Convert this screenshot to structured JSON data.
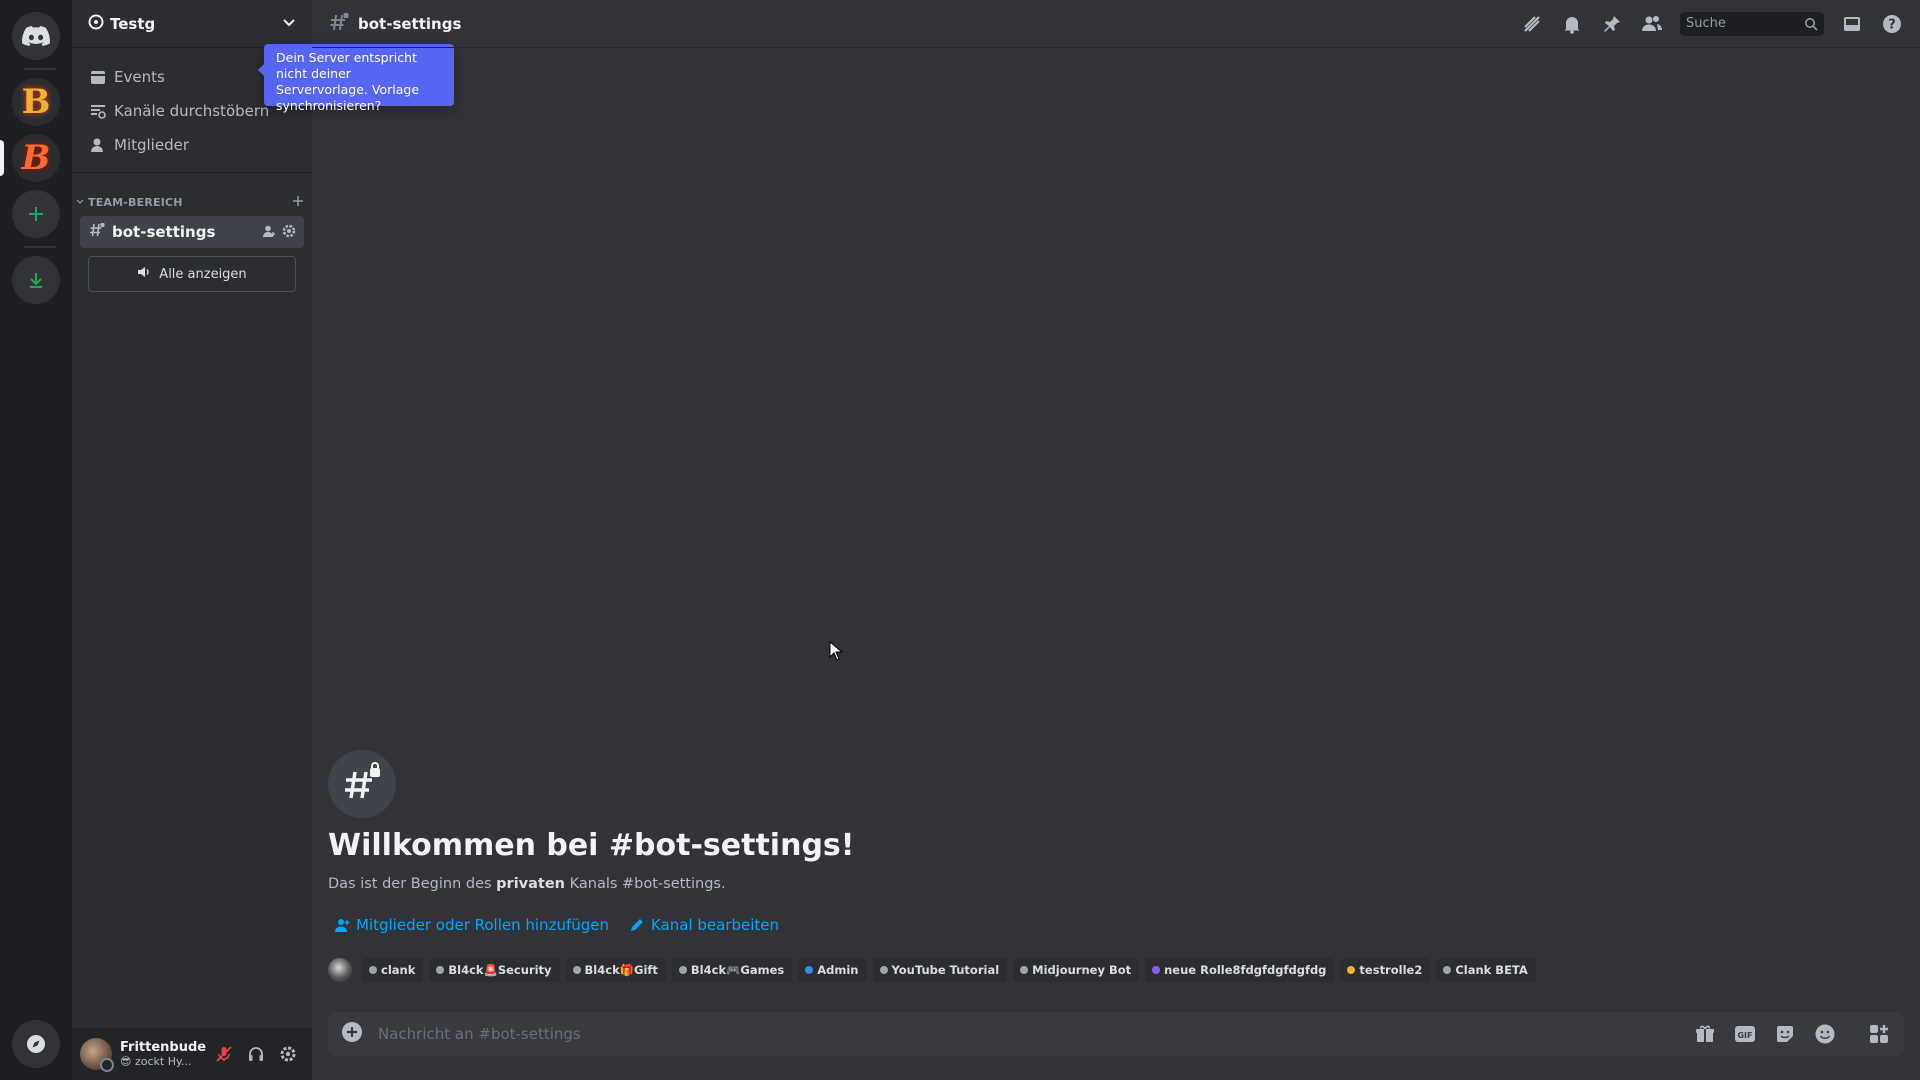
{
  "server": {
    "name": "Testg"
  },
  "tooltip": {
    "text": "Dein Server entspricht nicht deiner Servervorlage. Vorlage synchronisieren?"
  },
  "nav": [
    {
      "label": "Events",
      "icon": "calendar-icon"
    },
    {
      "label": "Kanäle durchstöbern",
      "icon": "browse-channels-icon"
    },
    {
      "label": "Mitglieder",
      "icon": "members-icon"
    }
  ],
  "category": {
    "label": "TEAM-BEREICH"
  },
  "channel": {
    "name": "bot-settings"
  },
  "show_all": {
    "label": "Alle anzeigen"
  },
  "user": {
    "name": "Frittenbude",
    "status": "😎 zockt Hy..."
  },
  "topbar": {
    "title": "bot-settings",
    "search_placeholder": "Suche"
  },
  "welcome": {
    "title": "Willkommen bei #bot-settings!",
    "sub_prefix": "Das ist der Beginn des ",
    "sub_bold": "privaten",
    "sub_suffix": " Kanals #bot-settings."
  },
  "actions": {
    "add_members": "Mitglieder oder Rollen hinzufügen",
    "edit_channel": "Kanal bearbeiten"
  },
  "roles": [
    {
      "name": "clank",
      "color": "#a0a4ab"
    },
    {
      "name": "Bl4ck🚨Security",
      "color": "#a0a4ab"
    },
    {
      "name": "Bl4ck🎁Gift",
      "color": "#a0a4ab"
    },
    {
      "name": "Bl4ck🎮Games",
      "color": "#a0a4ab"
    },
    {
      "name": "Admin",
      "color": "#3b88f5"
    },
    {
      "name": "YouTube Tutorial",
      "color": "#a0a4ab"
    },
    {
      "name": "Midjourney Bot",
      "color": "#a0a4ab"
    },
    {
      "name": "neue Rolle8fdgfdgfdgfdg",
      "color": "#8b5cf6"
    },
    {
      "name": "testrolle2",
      "color": "#f0b232"
    },
    {
      "name": "Clank BETA",
      "color": "#a0a4ab"
    }
  ],
  "composer": {
    "placeholder": "Nachricht an #bot-settings"
  },
  "colors": {
    "accent": "#5865f2",
    "link": "#00a8fc",
    "green": "#23a559",
    "danger": "#f23f43"
  }
}
